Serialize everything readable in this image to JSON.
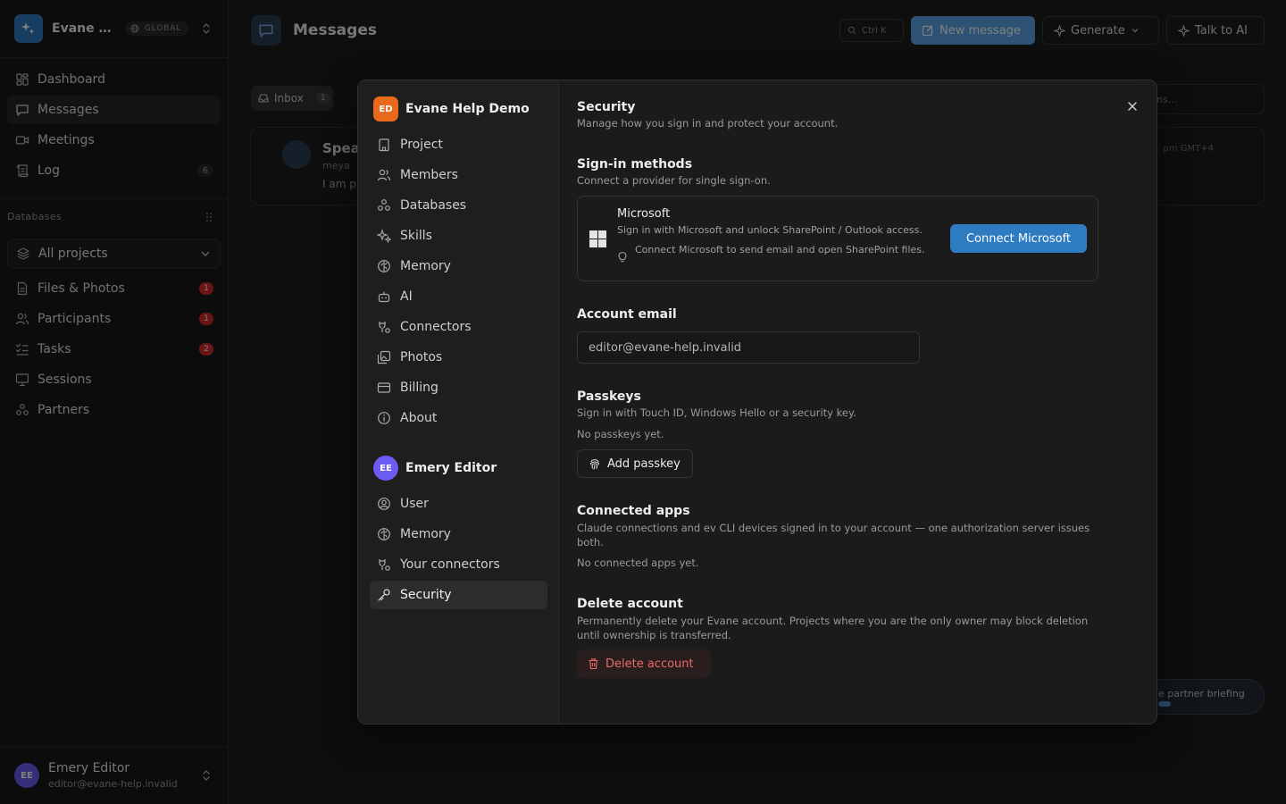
{
  "workspace": {
    "name": "Evane Help Demo",
    "short_name": "Evane He...",
    "badge": "GLOBAL"
  },
  "sidebar": {
    "nav": [
      {
        "label": "Dashboard"
      },
      {
        "label": "Messages"
      },
      {
        "label": "Meetings"
      },
      {
        "label": "Log",
        "count": "6"
      }
    ],
    "section_title": "Databases",
    "project_select": "All projects",
    "db_items": [
      {
        "label": "Files & Photos",
        "count": "1"
      },
      {
        "label": "Participants",
        "count": "1"
      },
      {
        "label": "Tasks",
        "count": "2"
      },
      {
        "label": "Sessions"
      },
      {
        "label": "Partners"
      }
    ],
    "user": {
      "initials": "EE",
      "name": "Emery Editor",
      "email": "editor@evane-help.invalid"
    }
  },
  "main": {
    "title": "Messages",
    "search_hint": "Ctrl K",
    "new_message": "New message",
    "generate": "Generate",
    "talk_to_ai": "Talk to AI",
    "inbox_tab": "Inbox",
    "inbox_count": "1",
    "card_title": "Speal",
    "card_line1": "meya",
    "card_line2": "I am p",
    "card_time": "pm GMT+4",
    "search_placeholder": "ns...",
    "briefing_pill": "e partner briefing"
  },
  "modal": {
    "project_group": {
      "initials": "ED",
      "name": "Evane Help Demo"
    },
    "project_items": [
      "Project",
      "Members",
      "Databases",
      "Skills",
      "Memory",
      "AI",
      "Connectors",
      "Photos",
      "Billing",
      "About"
    ],
    "user_group": {
      "initials": "EE",
      "name": "Emery Editor"
    },
    "user_items": [
      "User",
      "Memory",
      "Your connectors",
      "Security"
    ],
    "security": {
      "title": "Security",
      "subtitle": "Manage how you sign in and protect your account.",
      "signin_title": "Sign-in methods",
      "signin_sub": "Connect a provider for single sign-on.",
      "ms_name": "Microsoft",
      "ms_desc": "Sign in with Microsoft and unlock SharePoint / Outlook access.",
      "ms_tip": "Connect Microsoft to send email and open SharePoint files.",
      "ms_button": "Connect Microsoft",
      "email_title": "Account email",
      "email_value": "editor@evane-help.invalid",
      "passkeys_title": "Passkeys",
      "passkeys_sub": "Sign in with Touch ID, Windows Hello or a security key.",
      "passkeys_empty": "No passkeys yet.",
      "passkey_button": "Add passkey",
      "apps_title": "Connected apps",
      "apps_sub": "Claude connections and ev CLI devices signed in to your account — one authorization server issues both.",
      "apps_empty": "No connected apps yet.",
      "delete_title": "Delete account",
      "delete_sub": "Permanently delete your Evane account. Projects where you are the only owner may block deletion until ownership is transferred.",
      "delete_button": "Delete account"
    }
  },
  "colors": {
    "accent": "#2f7bc1",
    "danger": "#e86b6b",
    "project_avatar": "#e8691d",
    "user_avatar": "#6a5cf0",
    "badge_red": "#d92a2a"
  }
}
